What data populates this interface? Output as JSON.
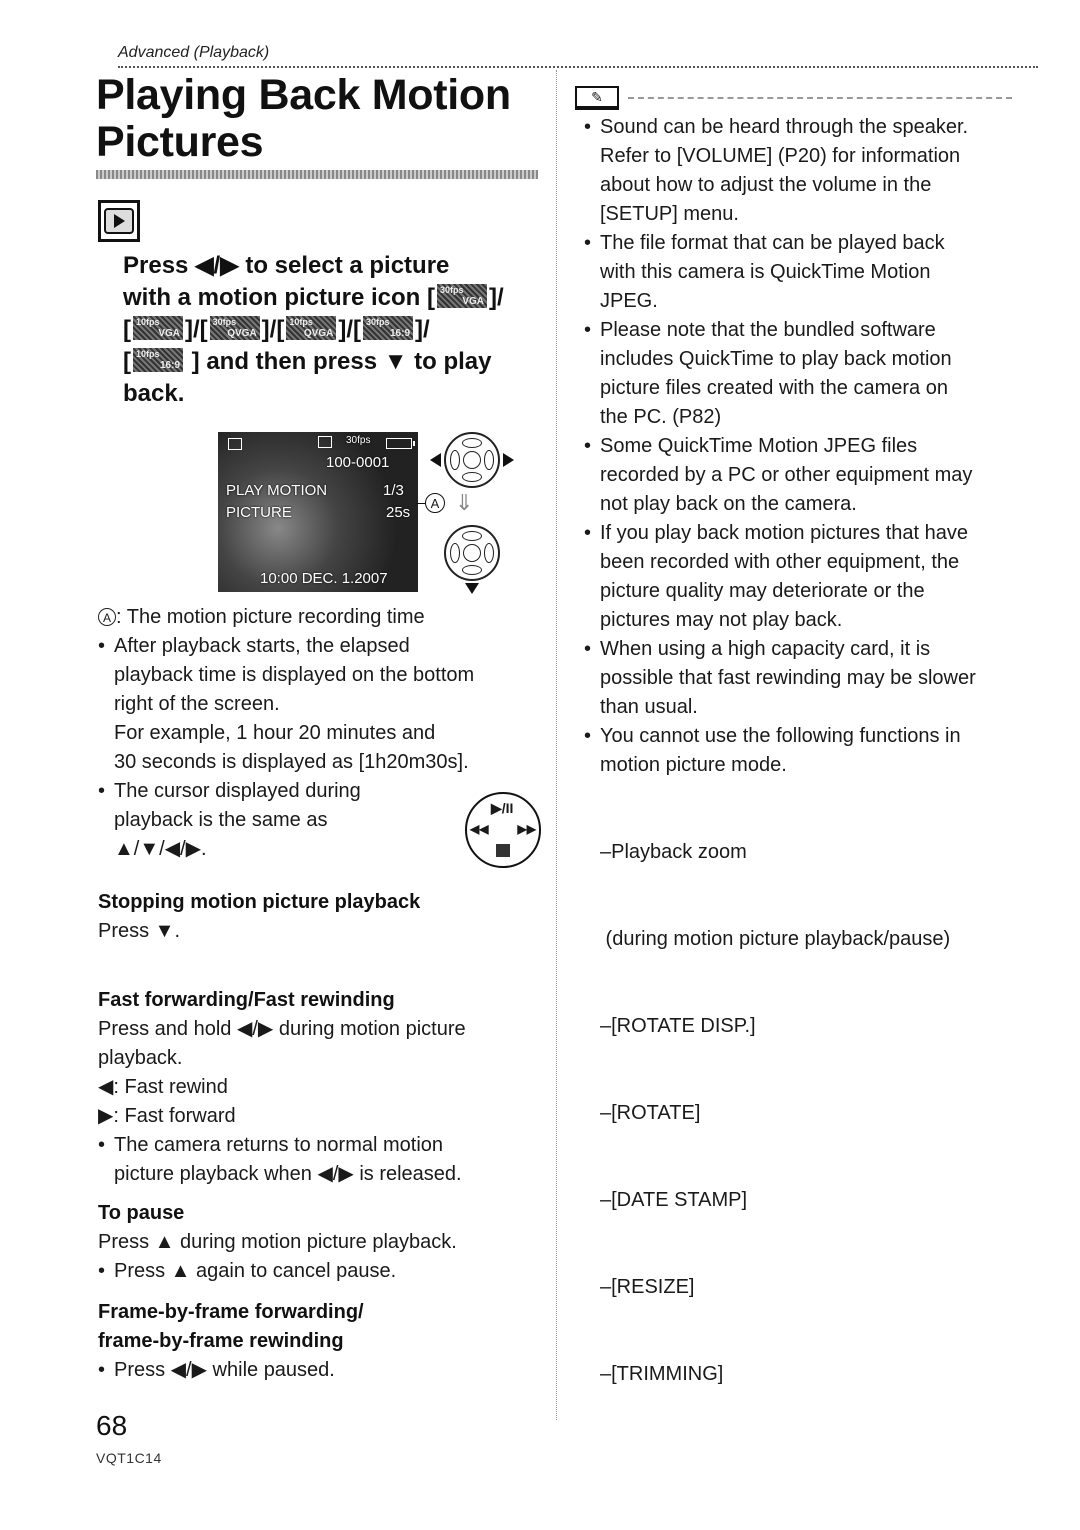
{
  "header": {
    "breadcrumb": "Advanced (Playback)",
    "title_line1": "Playing Back Motion",
    "title_line2": "Pictures"
  },
  "mode_icon": "playback-mode-icon",
  "step": {
    "line1_a": "Press",
    "line1_arrows": "◀/▶",
    "line1_b": "to select a picture",
    "line2": "with a motion picture icon [",
    "icons": [
      {
        "fps": "30fps",
        "format": "VGA"
      },
      {
        "fps": "10fps",
        "format": "VGA"
      },
      {
        "fps": "30fps",
        "format": "QVGA"
      },
      {
        "fps": "10fps",
        "format": "QVGA"
      },
      {
        "fps": "30fps",
        "format": "16:9"
      },
      {
        "fps": "10fps",
        "format": "16:9"
      }
    ],
    "sep": "]/",
    "open": "[",
    "line4_a": "] and then press",
    "line4_arrow": "▼",
    "line4_b": "to play",
    "line5": "back."
  },
  "lcd": {
    "file_number": "100-0001",
    "mode_line1": "PLAY MOTION",
    "mode_line2": "PICTURE",
    "frame_count": "1/3",
    "recording_time": "25s",
    "datetime": "10:00  DEC. 1.2007",
    "callout": "A"
  },
  "left": {
    "callout_label": "A",
    "callout_desc": ": The motion picture recording time",
    "elapsed": [
      "After playback starts, the elapsed",
      "playback time is displayed on the bottom",
      "right of the screen.",
      "For example, 1 hour 20 minutes and",
      "30 seconds is displayed as [1h20m30s]."
    ],
    "cursor_note": [
      "The cursor displayed during",
      "playback is the same as",
      "▲/▼/◀/▶."
    ],
    "cursor_icon": {
      "top": "▶/II",
      "left": "◀◀",
      "right": "▶▶"
    },
    "stop": {
      "heading": "Stopping motion picture playback",
      "text": "Press ▼."
    },
    "fast": {
      "heading": "Fast forwarding/Fast rewinding",
      "line1": "Press and hold ◀/▶ during motion picture",
      "line2": "playback.",
      "rewind": "◀:  Fast rewind",
      "forward": "▶:  Fast forward",
      "note1": "The camera returns to normal motion",
      "note2": "picture playback when ◀/▶ is released."
    },
    "pause": {
      "heading": "To pause",
      "text": "Press ▲ during motion picture playback.",
      "note": "Press ▲ again to cancel pause."
    },
    "frame": {
      "heading1": "Frame-by-frame forwarding/",
      "heading2": "frame-by-frame rewinding",
      "note": "Press ◀/▶ while paused."
    }
  },
  "right": {
    "notes": [
      [
        "Sound can be heard through the speaker.",
        "Refer to [VOLUME] (P20) for information",
        "about how to adjust the volume in the",
        "[SETUP] menu."
      ],
      [
        "The file format that can be played back",
        "with this camera is QuickTime Motion",
        "JPEG."
      ],
      [
        "Please note that the bundled software",
        "includes QuickTime to play back motion",
        "picture files created with the camera on",
        "the PC. (P82)"
      ],
      [
        "Some QuickTime Motion JPEG files",
        "recorded by a PC or other equipment may",
        "not play back on the camera."
      ],
      [
        "If you play back motion pictures that have",
        "been recorded with other equipment, the",
        "picture quality may deteriorate or the",
        "pictures may not play back."
      ],
      [
        "When using a high capacity card, it is",
        "possible that fast rewinding may be slower",
        "than usual."
      ],
      [
        "You cannot use the following functions in",
        "motion picture mode."
      ]
    ],
    "functions": [
      "–Playback zoom",
      " (during motion picture playback/pause)",
      "–[ROTATE DISP.]",
      "–[ROTATE]",
      "–[DATE STAMP]",
      "–[RESIZE]",
      "–[TRIMMING]"
    ]
  },
  "footer": {
    "page_number": "68",
    "model_code": "VQT1C14"
  }
}
